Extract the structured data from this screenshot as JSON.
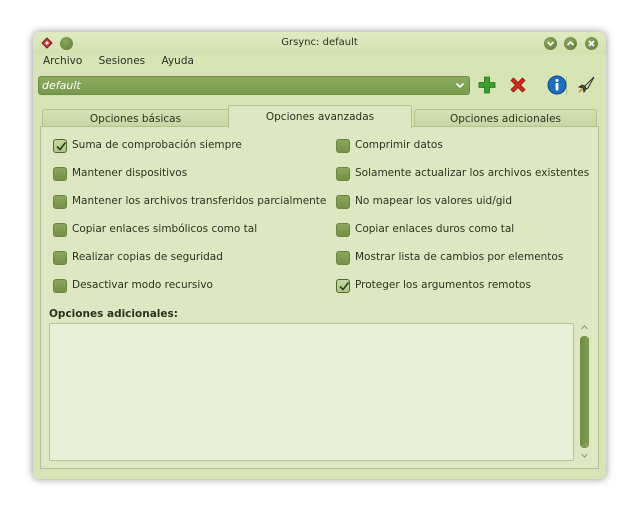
{
  "window": {
    "title": "Grsync: default"
  },
  "menu": [
    {
      "label": "Archivo"
    },
    {
      "label": "Sesiones"
    },
    {
      "label": "Ayuda"
    }
  ],
  "toolbar": {
    "session_value": "default",
    "add_icon": "plus-icon",
    "remove_icon": "delete-x-icon",
    "info_icon": "info-icon",
    "run_icon": "rocket-icon"
  },
  "tabs": [
    {
      "label": "Opciones básicas",
      "active": false
    },
    {
      "label": "Opciones avanzadas",
      "active": true
    },
    {
      "label": "Opciones adicionales",
      "active": false
    }
  ],
  "options_left": [
    {
      "label": "Suma de comprobación siempre",
      "checked": true
    },
    {
      "label": "Mantener dispositivos",
      "checked": false
    },
    {
      "label": "Mantener los archivos transferidos parcialmente",
      "checked": false
    },
    {
      "label": "Copiar enlaces simbólicos como tal",
      "checked": false
    },
    {
      "label": "Realizar copias de seguridad",
      "checked": false
    },
    {
      "label": "Desactivar modo recursivo",
      "checked": false
    }
  ],
  "options_right": [
    {
      "label": "Comprimir datos",
      "checked": false
    },
    {
      "label": "Solamente actualizar los archivos existentes",
      "checked": false
    },
    {
      "label": "No mapear los valores uid/gid",
      "checked": false
    },
    {
      "label": "Copiar enlaces duros como tal",
      "checked": false
    },
    {
      "label": "Mostrar lista de cambios por elementos",
      "checked": false
    },
    {
      "label": "Proteger los argumentos remotos",
      "checked": true
    }
  ],
  "extra": {
    "label": "Opciones adicionales:",
    "value": ""
  },
  "colors": {
    "accent": "#7a9b4e",
    "panel": "#dde8c2",
    "add": "#3aa02a",
    "remove": "#d12a1c",
    "info": "#1f6fbf"
  }
}
